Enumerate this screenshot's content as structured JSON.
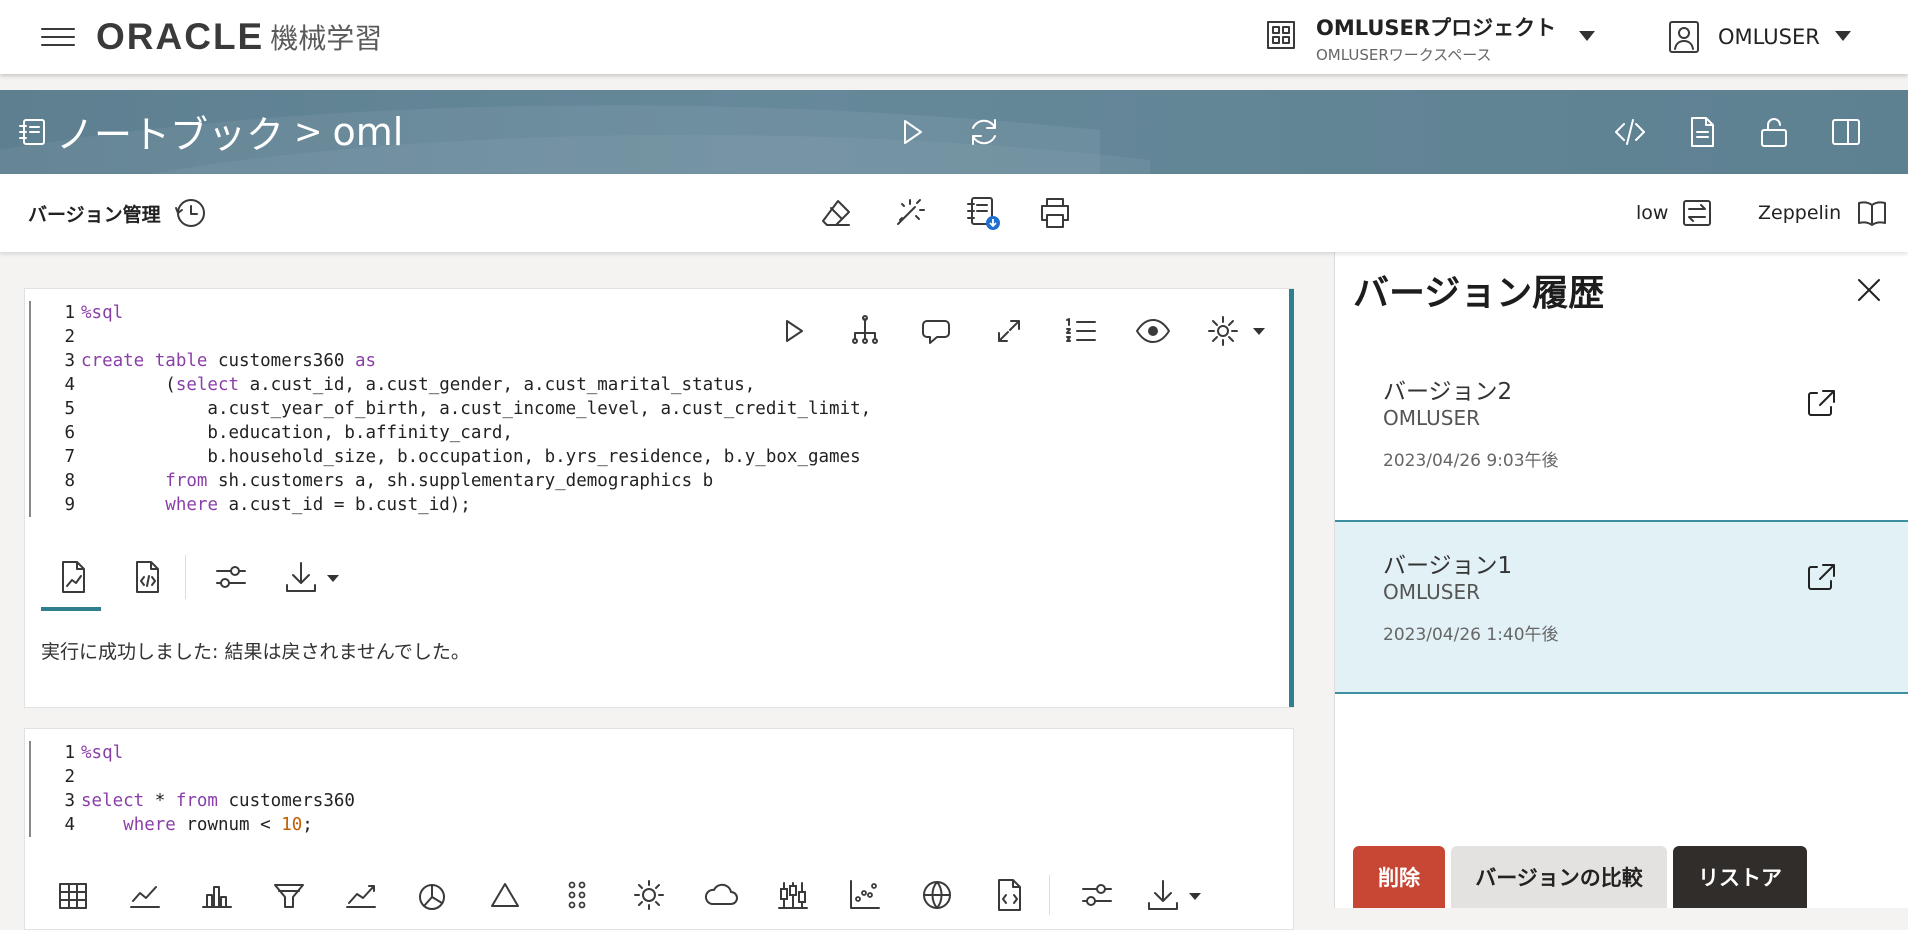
{
  "topbar": {
    "brand_oracle": "ORACLE",
    "brand_product": "機械学習",
    "project_name": "OMLUSERプロジェクト",
    "workspace_name": "OMLUSERワークスペース",
    "user_name": "OMLUSER"
  },
  "header": {
    "section": "ノートブック",
    "separator": ">",
    "notebook_name": "oml",
    "band_color": "#5f8293"
  },
  "toolbar": {
    "version_management_label": "バージョン管理",
    "connection_label": "low",
    "interpreter_label": "Zeppelin"
  },
  "paragraphs": [
    {
      "code_lines": [
        {
          "n": "1",
          "parts": [
            {
              "t": "%sql",
              "c": "kw"
            }
          ]
        },
        {
          "n": "2",
          "parts": [
            {
              "t": ""
            }
          ]
        },
        {
          "n": "3",
          "parts": [
            {
              "t": "create",
              "c": "kw"
            },
            {
              "t": " "
            },
            {
              "t": "table",
              "c": "kw"
            },
            {
              "t": " customers360 "
            },
            {
              "t": "as",
              "c": "kw"
            }
          ]
        },
        {
          "n": "4",
          "parts": [
            {
              "t": "        ("
            },
            {
              "t": "select",
              "c": "kw"
            },
            {
              "t": " a.cust_id, a.cust_gender, a.cust_marital_status,"
            }
          ]
        },
        {
          "n": "5",
          "parts": [
            {
              "t": "            a.cust_year_of_birth, a.cust_income_level, a.cust_credit_limit,"
            }
          ]
        },
        {
          "n": "6",
          "parts": [
            {
              "t": "            b.education, b.affinity_card,"
            }
          ]
        },
        {
          "n": "7",
          "parts": [
            {
              "t": "            b.household_size, b.occupation, b.yrs_residence, b.y_box_games"
            }
          ]
        },
        {
          "n": "8",
          "parts": [
            {
              "t": "        "
            },
            {
              "t": "from",
              "c": "kw"
            },
            {
              "t": " sh.customers a, sh.supplementary_demographics b"
            }
          ]
        },
        {
          "n": "9",
          "parts": [
            {
              "t": "        "
            },
            {
              "t": "where",
              "c": "kw"
            },
            {
              "t": " a.cust_id = b.cust_id);"
            }
          ]
        }
      ],
      "result_message": "実行に成功しました: 結果は戻されませんでした。"
    },
    {
      "code_lines": [
        {
          "n": "1",
          "parts": [
            {
              "t": "%sql",
              "c": "kw"
            }
          ]
        },
        {
          "n": "2",
          "parts": [
            {
              "t": ""
            }
          ]
        },
        {
          "n": "3",
          "parts": [
            {
              "t": "select",
              "c": "kw"
            },
            {
              "t": " * "
            },
            {
              "t": "from",
              "c": "kw"
            },
            {
              "t": " customers360"
            }
          ]
        },
        {
          "n": "4",
          "parts": [
            {
              "t": "    "
            },
            {
              "t": "where",
              "c": "kw"
            },
            {
              "t": " rownum < "
            },
            {
              "t": "10",
              "c": "num"
            },
            {
              "t": ";"
            }
          ]
        }
      ]
    }
  ],
  "version_panel": {
    "title": "バージョン履歴",
    "versions": [
      {
        "name": "バージョン2",
        "user": "OMLUSER",
        "date": "2023/04/26 9:03午後",
        "selected": false
      },
      {
        "name": "バージョン1",
        "user": "OMLUSER",
        "date": "2023/04/26 1:40午後",
        "selected": true
      }
    ],
    "delete_label": "削除",
    "compare_label": "バージョンの比較",
    "restore_label": "リストア"
  },
  "colors": {
    "accent": "#2f7f8f",
    "delete": "#c74634",
    "restore": "#312d2a",
    "selected_bg": "#e2f1f6"
  },
  "icons": [
    "hamburger-icon",
    "project-grid-icon",
    "user-badge-icon",
    "chevron-down-icon",
    "notebook-icon",
    "run-icon",
    "refresh-icon",
    "code-icon",
    "document-icon",
    "unlock-icon",
    "sidebar-panel-icon",
    "history-clock-icon",
    "eraser-icon",
    "sparkle-icon",
    "notebook-download-icon",
    "printer-icon",
    "swap-icon",
    "book-icon",
    "flowchart-icon",
    "comment-icon",
    "expand-icon",
    "numbered-list-icon",
    "eye-icon",
    "gear-icon",
    "chart-report-icon",
    "code-doc-icon",
    "sliders-icon",
    "download-icon",
    "table-icon",
    "line-chart-icon",
    "bar-chart-icon",
    "funnel-chart-icon",
    "trend-chart-icon",
    "pie-chart-icon",
    "triangle-icon",
    "dots-grid-icon",
    "sun-icon",
    "cloud-icon",
    "candlestick-icon",
    "scatter-icon",
    "globe-icon",
    "close-icon",
    "open-external-icon"
  ]
}
